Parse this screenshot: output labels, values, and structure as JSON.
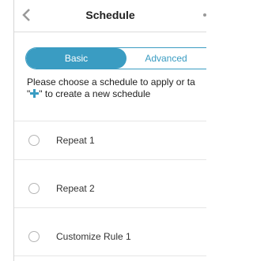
{
  "header": {
    "title": "Schedule",
    "back_icon": "chevron-left-icon"
  },
  "tabs": [
    {
      "label": "Basic",
      "selected": true
    },
    {
      "label": "Advanced",
      "selected": false
    }
  ],
  "instruction": {
    "line1": "Please choose a schedule to apply or ta",
    "line2_prefix": "\"",
    "line2_suffix": "\" to create a new schedule",
    "icon": "plus-icon"
  },
  "schedules": [
    {
      "label": "Repeat 1",
      "selected": false
    },
    {
      "label": "Repeat 2",
      "selected": false
    },
    {
      "label": "Customize Rule 1",
      "selected": false
    }
  ],
  "colors": {
    "accent": "#3a9cc2"
  }
}
